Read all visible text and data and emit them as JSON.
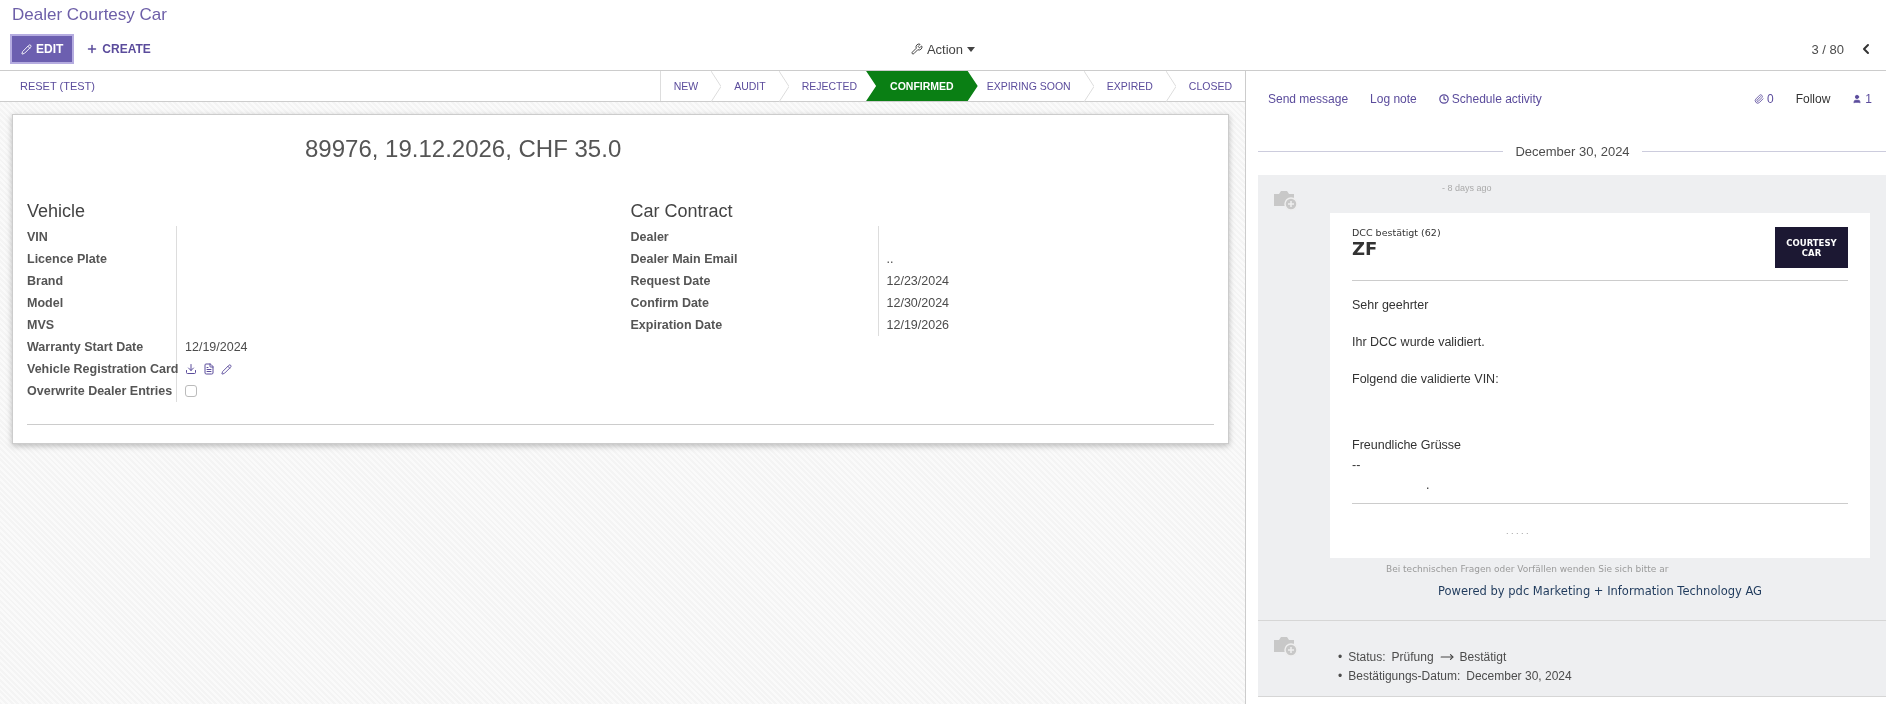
{
  "header": {
    "title": "Dealer Courtesy Car",
    "buttons": [
      {
        "label": "EDIT",
        "kind": "primary"
      },
      {
        "label": "CREATE",
        "kind": "link"
      }
    ],
    "action": "Action",
    "pager": "3 / 80"
  },
  "statusbar": {
    "buttons": [
      "RESET (TEST)"
    ],
    "stages": [
      {
        "label": "NEW",
        "selected": false
      },
      {
        "label": "AUDIT",
        "selected": false
      },
      {
        "label": "REJECTED",
        "selected": false
      },
      {
        "label": "CONFIRMED",
        "selected": true
      },
      {
        "label": "EXPIRING SOON",
        "selected": false
      },
      {
        "label": "EXPIRED",
        "selected": false
      },
      {
        "label": "CLOSED",
        "selected": false
      }
    ]
  },
  "form": {
    "title": "89976, 19.12.2026, CHF 35.0",
    "groups": [
      {
        "title": "Vehicle",
        "fields": [
          {
            "label": "VIN",
            "kind": "text"
          },
          {
            "label": "Licence Plate",
            "kind": "text"
          },
          {
            "label": "Brand",
            "kind": "text"
          },
          {
            "label": "Model",
            "kind": "text"
          },
          {
            "label": "MVS",
            "kind": "text"
          },
          {
            "label": "Warranty Start Date",
            "kind": "text",
            "value": "12/19/2024"
          },
          {
            "label": "Vehicle Registration Card",
            "kind": "attachment"
          },
          {
            "label": "Overwrite Dealer Entries",
            "kind": "checkbox",
            "checked": false
          }
        ]
      },
      {
        "title": "Car Contract",
        "fields": [
          {
            "label": "Dealer",
            "kind": "text"
          },
          {
            "label": "Dealer Main Email",
            "kind": "text",
            "value": ".."
          },
          {
            "label": "Request Date",
            "kind": "text",
            "value": "12/23/2024"
          },
          {
            "label": "Confirm Date",
            "kind": "text",
            "value": "12/30/2024"
          },
          {
            "label": "Expiration Date",
            "kind": "text",
            "value": "12/19/2026"
          }
        ]
      }
    ]
  },
  "chatter": {
    "actions": [
      "Send message",
      "Log note",
      "Schedule activity"
    ],
    "attachments": "0",
    "follow": "Follow",
    "followers": "1",
    "date": "December 30, 2024",
    "messages": [
      {
        "kind": "email",
        "time": "- 8 days ago",
        "email": {
          "subtitle": "DCC bestätigt (62)",
          "heading": "ZF",
          "logo": [
            "COURTESY",
            "CAR"
          ],
          "paragraphs": [
            "Sehr geehrter",
            "Ihr DCC wurde validiert.",
            "Folgend die validierte VIN:"
          ],
          "closing": "Freundliche Grüsse",
          "signature": [
            "--",
            "."
          ],
          "footer_dots": ". . . . .",
          "notice": "Bei technischen Fragen oder Vorfällen wenden Sie sich bitte ar",
          "powered": "Powered by pdc Marketing + Information Technology AG"
        }
      },
      {
        "kind": "tracking",
        "changes": [
          {
            "marker": "•",
            "label": "Status:",
            "old": "Prüfung",
            "new": "Bestätigt"
          },
          {
            "marker": "•",
            "label": "Bestätigungs-Datum:",
            "new": "December 30, 2024"
          }
        ]
      }
    ]
  }
}
